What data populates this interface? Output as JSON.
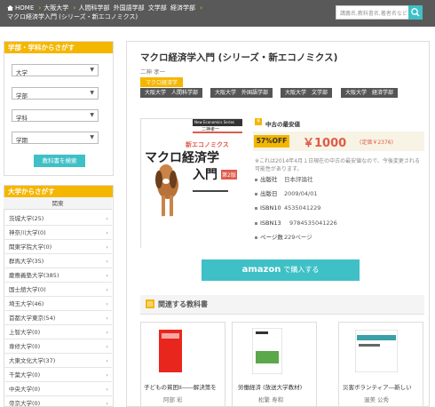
{
  "header": {
    "breadcrumbs": [
      "HOME",
      "大阪大学",
      "人間科学部",
      "外国語学部",
      "文学部",
      "経済学部"
    ],
    "breadcrumb_current": "マクロ経済学入門 (シリーズ・新エコノミクス)",
    "search_placeholder": "講義名,教科書名,著者名など"
  },
  "sidebar": {
    "filter_title": "学部・学科からさがす",
    "selects": [
      "大学",
      "学部",
      "学科",
      "学期"
    ],
    "search_button": "教科書を検索",
    "uni_title": "大学からさがす",
    "kanto_label": "関東",
    "universities": [
      "茨城大学(25)",
      "神奈川大学(0)",
      "関東学院大学(0)",
      "群馬大学(35)",
      "慶應義塾大学(385)",
      "国士舘大学(0)",
      "埼玉大学(46)",
      "首都大学東京(54)",
      "上智大学(0)",
      "専修大学(0)",
      "大東文化大学(37)",
      "千葉大学(0)",
      "中央大学(0)",
      "帝京大学(0)"
    ]
  },
  "book": {
    "title": "マクロ経済学入門 (シリーズ・新エコノミクス)",
    "author": "二神 孝一",
    "tag_main": "マクロ経済学",
    "course_tags": [
      "大阪大学　人間科学部",
      "大阪大学　外国語学部",
      "大阪大学　文学部",
      "大阪大学　経済学部"
    ],
    "cover_series": "New Economics Series",
    "cover_author": "二神孝一",
    "cover_series_jp": "新エコノミクス",
    "cover_title_1": "マクロ経済学",
    "cover_title_2": "入門",
    "cover_edition": "第2版",
    "cheapest_label": "中古の最安値",
    "discount": "57%OFF",
    "price": "￥1000",
    "list_price": "(定価￥2376)",
    "note": "※これは2014年4月１日現在の中古の最安値なので、今後変更される可能性があります。",
    "specs": [
      {
        "label": "出版社",
        "value": "日本評論社"
      },
      {
        "label": "出版日",
        "value": "2009/04/01"
      },
      {
        "label": "ISBN10",
        "value": "4535041229"
      },
      {
        "label": "ISBN13",
        "value": "9784535041226"
      },
      {
        "label": "ページ数",
        "value": "229ページ"
      }
    ],
    "amazon_logo": "amazon",
    "amazon_label": "で購入する"
  },
  "related": {
    "title": "関連する教科書",
    "items": [
      {
        "name": "子どもの貧困II――解決策を",
        "author": "阿部 彩"
      },
      {
        "name": "労働経済 (放送大学教材)",
        "author": "松繁 寿和"
      },
      {
        "name": "災害ボランティア―新しい",
        "author": "渥美 公秀"
      }
    ]
  },
  "colors": {
    "accent": "#f5b600",
    "teal": "#3ec0c6",
    "price_red": "#e05a4a",
    "header": "#595959"
  }
}
